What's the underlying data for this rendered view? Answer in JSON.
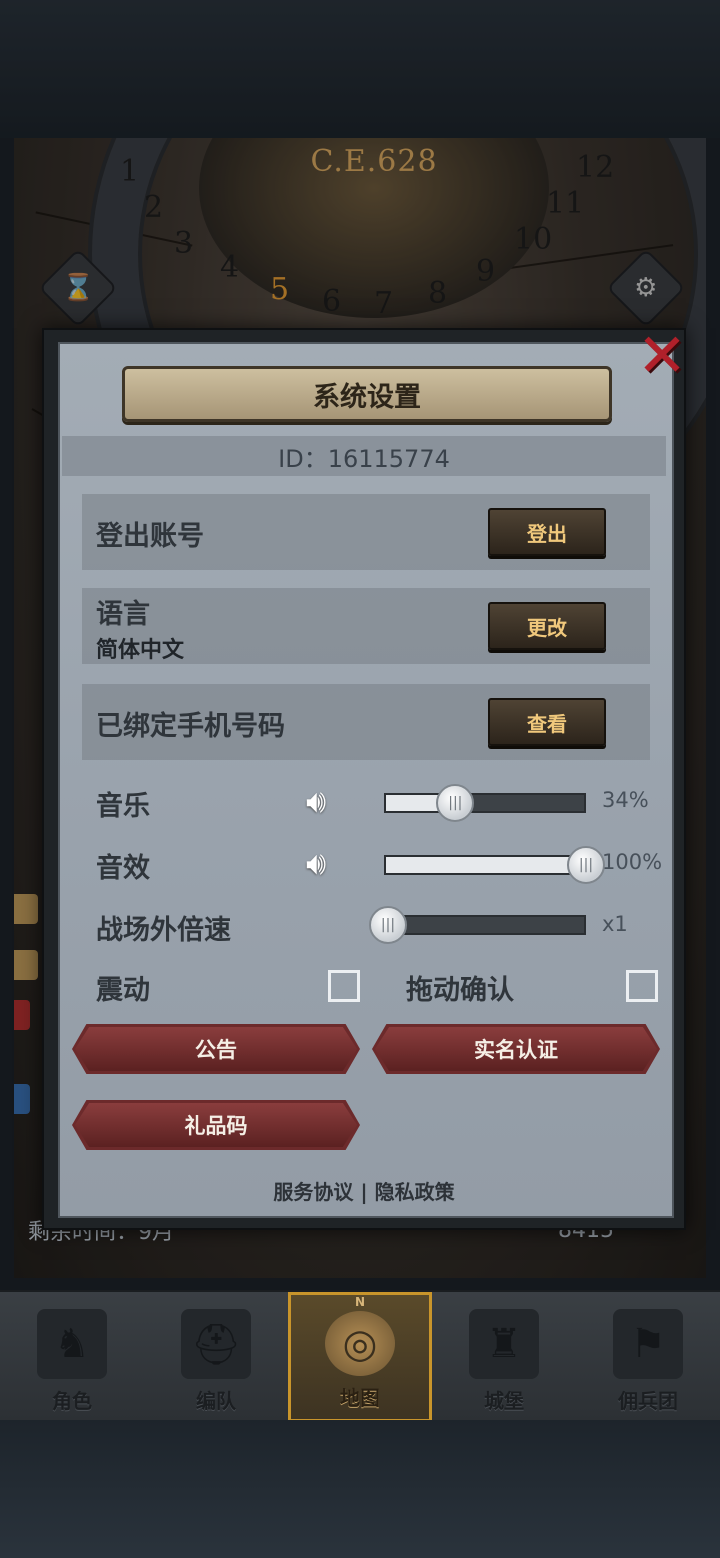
{
  "map": {
    "era": "C.E.628",
    "dial_numbers": [
      "1",
      "2",
      "3",
      "4",
      "5",
      "6",
      "7",
      "8",
      "9",
      "10",
      "11",
      "12"
    ],
    "active_number": "5",
    "remaining_time_label": "剩余时间：9月",
    "resource_value": "8415",
    "side_labels": [
      "4",
      "6"
    ]
  },
  "dialog": {
    "title": "系统设置",
    "id_text": "ID：16115774",
    "logout": {
      "label": "登出账号",
      "button": "登出"
    },
    "language": {
      "label": "语言",
      "value": "简体中文",
      "button": "更改"
    },
    "phone": {
      "label": "已绑定手机号码",
      "button": "查看"
    },
    "music": {
      "label": "音乐",
      "value_text": "34%",
      "level": 0.34
    },
    "sound": {
      "label": "音效",
      "value_text": "100%",
      "level": 1.0
    },
    "speed": {
      "label": "战场外倍速",
      "value_text": "x1",
      "level": 0.0
    },
    "vibrate": {
      "label": "震动",
      "checked": false
    },
    "drag_confirm": {
      "label": "拖动确认",
      "checked": false
    },
    "buttons": {
      "notice": "公告",
      "realname": "实名认证",
      "giftcode": "礼品码"
    },
    "footer": {
      "service": "服务协议",
      "separator": "|",
      "privacy": "隐私政策"
    }
  },
  "nav": {
    "items": [
      {
        "label": "角色",
        "icon": "knight-icon"
      },
      {
        "label": "编队",
        "icon": "helmet-icon"
      },
      {
        "label": "地图",
        "icon": "compass-map-icon"
      },
      {
        "label": "城堡",
        "icon": "castle-icon"
      },
      {
        "label": "佣兵团",
        "icon": "banner-icon"
      }
    ],
    "active_index": 2,
    "compass_letter": "N"
  },
  "colors": {
    "accent_gold": "#c9952b",
    "button_text_gold": "#f0c87c",
    "close_red": "#b0202a",
    "red_button": "#6c2a2b"
  }
}
